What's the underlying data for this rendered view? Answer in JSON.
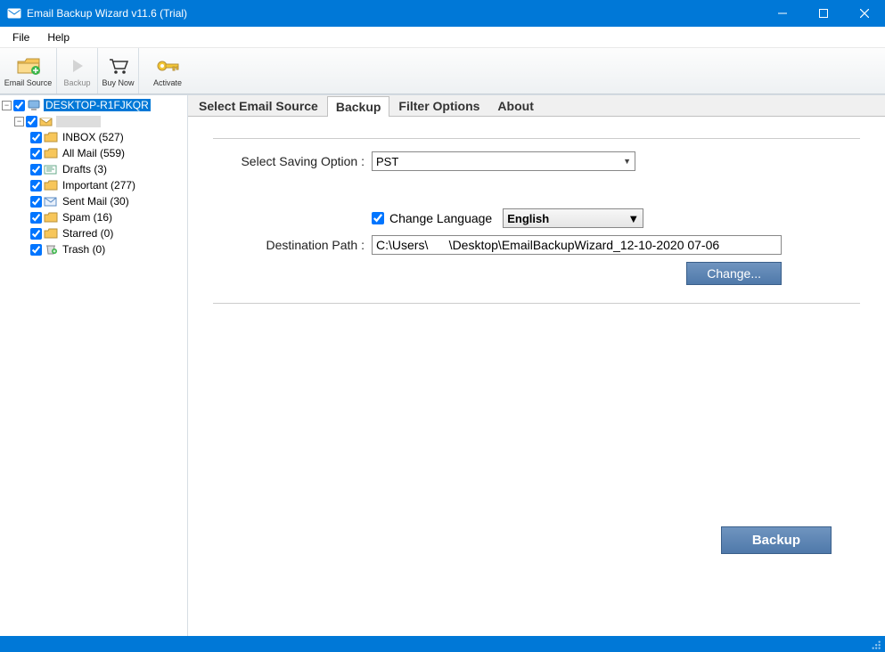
{
  "window": {
    "title": "Email Backup Wizard v11.6 (Trial)"
  },
  "menu": {
    "file": "File",
    "help": "Help"
  },
  "toolbar": {
    "email_source": "Email Source",
    "backup": "Backup",
    "buy_now": "Buy Now",
    "activate": "Activate"
  },
  "tree": {
    "expand_minus": "−",
    "root": "DESKTOP-R1FJKQR",
    "account_obscured": "",
    "items": [
      {
        "label": "INBOX (527)"
      },
      {
        "label": "All Mail (559)"
      },
      {
        "label": "Drafts (3)"
      },
      {
        "label": "Important (277)"
      },
      {
        "label": "Sent Mail (30)"
      },
      {
        "label": "Spam (16)"
      },
      {
        "label": "Starred (0)"
      },
      {
        "label": "Trash (0)"
      }
    ]
  },
  "tabs": {
    "select_email_source": "Select Email Source",
    "backup": "Backup",
    "filter_options": "Filter Options",
    "about": "About"
  },
  "form": {
    "saving_label": "Select Saving Option :",
    "saving_value": "PST",
    "change_language_label": "Change Language",
    "language_value": "English",
    "dest_label": "Destination Path :",
    "dest_value": "C:\\Users\\      \\Desktop\\EmailBackupWizard_12-10-2020 07-06",
    "change_btn": "Change...",
    "backup_btn": "Backup"
  }
}
